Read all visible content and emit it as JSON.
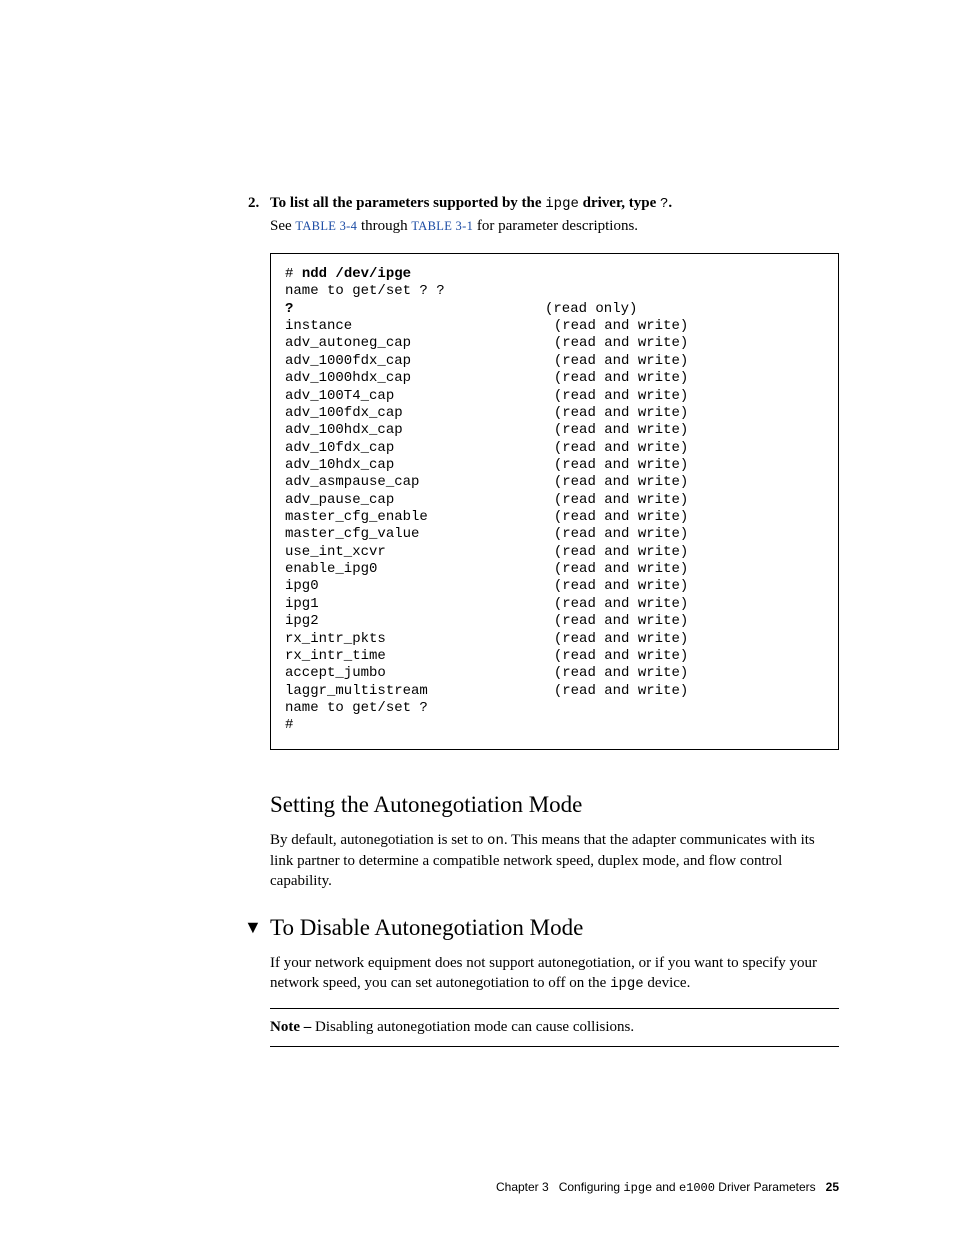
{
  "step": {
    "num": "2.",
    "prefix": "To list all the parameters supported by the ",
    "driver": "ipge",
    "middle": " driver, type ",
    "q": "?",
    "suffix": "."
  },
  "ref": {
    "prefix": "See ",
    "link1": "TABLE 3-4",
    "mid": " through ",
    "link2": "TABLE 3-1",
    "suffix": " for parameter descriptions."
  },
  "code": {
    "l0": "# ",
    "l0b": "ndd /dev/ipge",
    "l1": "name to get/set ? ?",
    "q": "?",
    "ro": "(read only)",
    "rw": "(read and write)",
    "params": [
      "instance",
      "adv_autoneg_cap",
      "adv_1000fdx_cap",
      "adv_1000hdx_cap",
      "adv_100T4_cap",
      "adv_100fdx_cap",
      "adv_100hdx_cap",
      "adv_10fdx_cap",
      "adv_10hdx_cap",
      "adv_asmpause_cap",
      "adv_pause_cap",
      "master_cfg_enable",
      "master_cfg_value",
      "use_int_xcvr",
      "enable_ipg0",
      "ipg0",
      "ipg1",
      "ipg2",
      "rx_intr_pkts",
      "rx_intr_time",
      "accept_jumbo",
      "laggr_multistream"
    ],
    "trail1": "name to get/set ?",
    "trail2": "#"
  },
  "h_autoneg": "Setting the Autonegotiation Mode",
  "p_autoneg_a": "By default, autonegotiation is set to ",
  "p_autoneg_on": "on",
  "p_autoneg_b": ". This means that the adapter communicates with its link partner to determine a compatible network speed, duplex mode, and flow control capability.",
  "h_disable": "To Disable Autonegotiation Mode",
  "p_disable_a": "If your network equipment does not support autonegotiation, or if you want to specify your network speed, you can set autonegotiation to off on the ",
  "p_disable_dev": "ipge",
  "p_disable_b": " device.",
  "note_label": "Note – ",
  "note_text": "Disabling autonegotiation mode can cause collisions.",
  "footer": {
    "chapter": "Chapter 3",
    "title_a": "Configuring ",
    "m1": "ipge",
    "title_b": " and ",
    "m2": "e1000",
    "title_c": " Driver Parameters",
    "page": "25"
  }
}
